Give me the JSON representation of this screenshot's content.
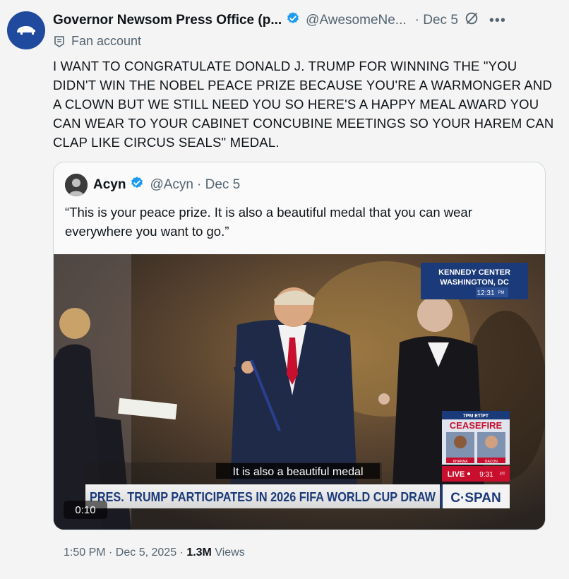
{
  "author": {
    "name": "Governor Newsom Press Office (p...",
    "handle": "@AwesomeNe...",
    "date": "· Dec 5",
    "label": "Fan account"
  },
  "tweet": {
    "text": "I WANT TO CONGRATULATE DONALD J. TRUMP FOR WINNING THE \"YOU DIDN'T WIN THE NOBEL PEACE PRIZE BECAUSE YOU'RE A WARMONGER AND A CLOWN BUT WE STILL NEED YOU SO HERE'S A HAPPY MEAL AWARD YOU CAN WEAR TO YOUR CABINET CONCUBINE MEETINGS SO YOUR HAREM CAN CLAP LIKE CIRCUS SEALS\" MEDAL."
  },
  "quote": {
    "name": "Acyn",
    "handle": "@Acyn",
    "date": "· Dec 5",
    "text": "“This is your peace prize. It is also a beautiful medal that you can wear everywhere you want to go.”"
  },
  "video": {
    "location_line1": "KENNEDY CENTER",
    "location_line2": "WASHINGTON, DC",
    "clock": "12:31",
    "clock_suffix": "PM",
    "subtitle": "It is also a beautiful medal",
    "banner": "PRES. TRUMP PARTICIPATES IN 2026 FIFA WORLD CUP DRAW",
    "network": "C·SPAN",
    "promo_time": "7PM ET/PT",
    "promo_title": "CEASEFIRE",
    "promo_name1": "KHANNA",
    "promo_name2": "BACON",
    "live_label": "LIVE",
    "live_time": "9:31",
    "live_suffix": "PT",
    "duration": "0:10"
  },
  "footer": {
    "time": "1:50 PM · Dec 5, 2025 · ",
    "views_count": "1.3M",
    "views_label": " Views"
  },
  "colors": {
    "verified": "#1d9bf0",
    "avatar_bg": "#1f4a9e",
    "cspan_blue": "#1b3a7a",
    "live_red": "#c8102e"
  }
}
